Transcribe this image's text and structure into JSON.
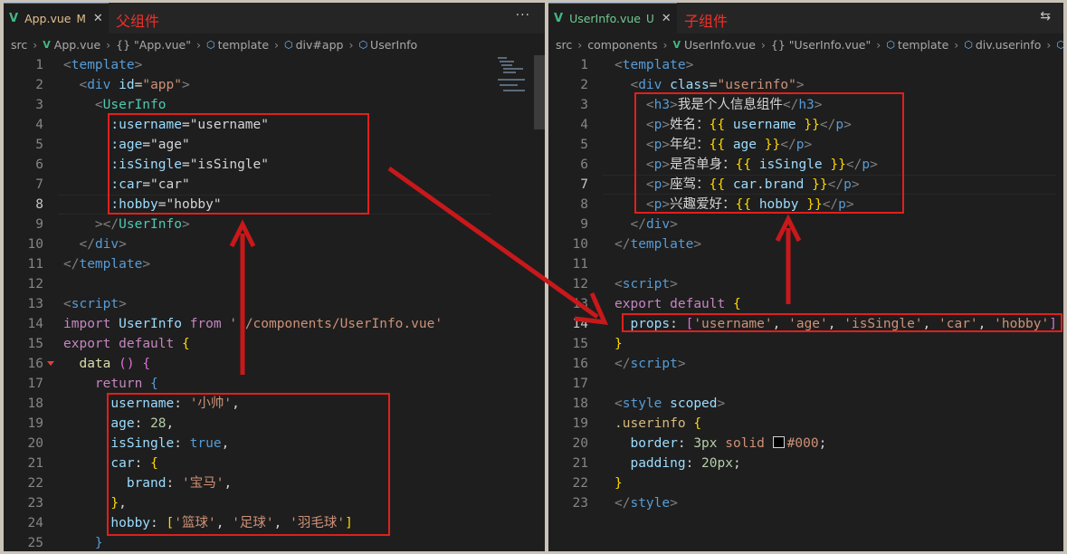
{
  "left": {
    "tab": {
      "icon": "vue-logo-icon",
      "name": "App.vue",
      "status": "M",
      "close": "✕"
    },
    "annotation": "父组件",
    "more": "···",
    "breadcrumb": [
      "src",
      "App.vue",
      "{} \"App.vue\"",
      "template",
      "div#app",
      "UserInfo"
    ],
    "lines": [
      {
        "n": "1",
        "html": "<span class='t'>&lt;</span><span class='tag'>template</span><span class='t'>&gt;</span>"
      },
      {
        "n": "2",
        "html": "  <span class='t'>&lt;</span><span class='tag'>div</span> <span class='attr'>id</span><span class='pl'>=</span><span class='str'>\"app\"</span><span class='t'>&gt;</span>"
      },
      {
        "n": "3",
        "html": "    <span class='t'>&lt;</span><span class='cls'>UserInfo</span>"
      },
      {
        "n": "4",
        "html": "      <span class='attr'>:username</span><span class='pl'>=</span><span class='pl'>\"username\"</span>"
      },
      {
        "n": "5",
        "html": "      <span class='attr'>:age</span><span class='pl'>=</span><span class='pl'>\"age\"</span>"
      },
      {
        "n": "6",
        "html": "      <span class='attr'>:isSingle</span><span class='pl'>=</span><span class='pl'>\"isSingle\"</span>"
      },
      {
        "n": "7",
        "html": "      <span class='attr'>:car</span><span class='pl'>=</span><span class='pl'>\"car\"</span>"
      },
      {
        "n": "8",
        "html": "      <span class='attr'>:hobby</span><span class='pl'>=</span><span class='pl'>\"hobby\"</span>"
      },
      {
        "n": "9",
        "html": "    <span class='t'>&gt;&lt;/</span><span class='cls'>UserInfo</span><span class='t'>&gt;</span>"
      },
      {
        "n": "10",
        "html": "  <span class='t'>&lt;/</span><span class='tag'>div</span><span class='t'>&gt;</span>"
      },
      {
        "n": "11",
        "html": "<span class='t'>&lt;/</span><span class='tag'>template</span><span class='t'>&gt;</span>"
      },
      {
        "n": "12",
        "html": ""
      },
      {
        "n": "13",
        "html": "<span class='t'>&lt;</span><span class='tag'>script</span><span class='t'>&gt;</span>"
      },
      {
        "n": "14",
        "html": "<span class='kw'>import</span> <span class='attr'>UserInfo</span> <span class='kw'>from</span> <span class='str'>'./components/UserInfo.vue'</span>"
      },
      {
        "n": "15",
        "html": "<span class='kw'>export</span> <span class='kw'>default</span> <span class='br'>{</span>"
      },
      {
        "n": "16",
        "html": "  <span class='fn'>data</span> <span class='br2'>()</span> <span class='br2'>{</span>"
      },
      {
        "n": "17",
        "html": "    <span class='kw'>return</span> <span class='kw2'>{</span>"
      },
      {
        "n": "18",
        "html": "      <span class='attr'>username</span><span class='pl'>:</span> <span class='str'>'小帅'</span><span class='pl'>,</span>"
      },
      {
        "n": "19",
        "html": "      <span class='attr'>age</span><span class='pl'>:</span> <span class='num'>28</span><span class='pl'>,</span>"
      },
      {
        "n": "20",
        "html": "      <span class='attr'>isSingle</span><span class='pl'>:</span> <span class='kw2'>true</span><span class='pl'>,</span>"
      },
      {
        "n": "21",
        "html": "      <span class='attr'>car</span><span class='pl'>:</span> <span class='br'>{</span>"
      },
      {
        "n": "22",
        "html": "        <span class='attr'>brand</span><span class='pl'>:</span> <span class='str'>'宝马'</span><span class='pl'>,</span>"
      },
      {
        "n": "23",
        "html": "      <span class='br'>}</span><span class='pl'>,</span>"
      },
      {
        "n": "24",
        "html": "      <span class='attr'>hobby</span><span class='pl'>:</span> <span class='br'>[</span><span class='str'>'篮球'</span><span class='pl'>,</span> <span class='str'>'足球'</span><span class='pl'>,</span> <span class='str'>'羽毛球'</span><span class='br'>]</span>"
      },
      {
        "n": "25",
        "html": "    <span class='kw2'>}</span>"
      }
    ]
  },
  "right": {
    "tab": {
      "icon": "vue-logo-icon",
      "name": "UserInfo.vue",
      "status": "U",
      "close": "✕"
    },
    "annotation": "子组件",
    "compare_icon": "⇆",
    "breadcrumb": [
      "src",
      "components",
      "UserInfo.vue",
      "{} \"UserInfo.vue\"",
      "template",
      "div.userinfo"
    ],
    "lines": [
      {
        "n": "1",
        "html": "<span class='t'>&lt;</span><span class='tag'>template</span><span class='t'>&gt;</span>"
      },
      {
        "n": "2",
        "html": "  <span class='t'>&lt;</span><span class='tag'>div</span> <span class='attr'>class</span><span class='pl'>=</span><span class='str'>\"userinfo\"</span><span class='t'>&gt;</span>"
      },
      {
        "n": "3",
        "html": "    <span class='t'>&lt;</span><span class='tag'>h3</span><span class='t'>&gt;</span><span class='pl'>我是个人信息组件</span><span class='t'>&lt;/</span><span class='tag'>h3</span><span class='t'>&gt;</span>"
      },
      {
        "n": "4",
        "html": "    <span class='t'>&lt;</span><span class='tag'>p</span><span class='t'>&gt;</span><span class='pl'>姓名：</span><span class='br'>{{</span> <span class='attr'>username</span> <span class='br'>}}</span><span class='t'>&lt;/</span><span class='tag'>p</span><span class='t'>&gt;</span>"
      },
      {
        "n": "5",
        "html": "    <span class='t'>&lt;</span><span class='tag'>p</span><span class='t'>&gt;</span><span class='pl'>年纪：</span><span class='br'>{{</span> <span class='attr'>age</span> <span class='br'>}}</span><span class='t'>&lt;/</span><span class='tag'>p</span><span class='t'>&gt;</span>"
      },
      {
        "n": "6",
        "html": "    <span class='t'>&lt;</span><span class='tag'>p</span><span class='t'>&gt;</span><span class='pl'>是否单身：</span><span class='br'>{{</span> <span class='attr'>isSingle</span> <span class='br'>}}</span><span class='t'>&lt;/</span><span class='tag'>p</span><span class='t'>&gt;</span>"
      },
      {
        "n": "7",
        "html": "    <span class='t'>&lt;</span><span class='tag'>p</span><span class='t'>&gt;</span><span class='pl'>座驾：</span><span class='br'>{{</span> <span class='attr'>car</span><span class='pl'>.</span><span class='attr'>brand</span> <span class='br'>}}</span><span class='t'>&lt;/</span><span class='tag'>p</span><span class='t'>&gt;</span>"
      },
      {
        "n": "8",
        "html": "    <span class='t'>&lt;</span><span class='tag'>p</span><span class='t'>&gt;</span><span class='pl'>兴趣爱好：</span><span class='br'>{{</span> <span class='attr'>hobby</span> <span class='br'>}}</span><span class='t'>&lt;/</span><span class='tag'>p</span><span class='t'>&gt;</span>"
      },
      {
        "n": "9",
        "html": "  <span class='t'>&lt;/</span><span class='tag'>div</span><span class='t'>&gt;</span>"
      },
      {
        "n": "10",
        "html": "<span class='t'>&lt;/</span><span class='tag'>template</span><span class='t'>&gt;</span>"
      },
      {
        "n": "11",
        "html": ""
      },
      {
        "n": "12",
        "html": "<span class='t'>&lt;</span><span class='tag'>script</span><span class='t'>&gt;</span>"
      },
      {
        "n": "13",
        "html": "<span class='kw'>export</span> <span class='kw'>default</span> <span class='br'>{</span>"
      },
      {
        "n": "14",
        "html": "  <span class='attr'>props</span><span class='pl'>:</span> <span class='br2'>[</span><span class='str'>'username'</span><span class='pl'>,</span> <span class='str'>'age'</span><span class='pl'>,</span> <span class='str'>'isSingle'</span><span class='pl'>,</span> <span class='str'>'car'</span><span class='pl'>,</span> <span class='str'>'hobby'</span><span class='br2'>]</span>"
      },
      {
        "n": "15",
        "html": "<span class='br'>}</span>"
      },
      {
        "n": "16",
        "html": "<span class='t'>&lt;/</span><span class='tag'>script</span><span class='t'>&gt;</span>"
      },
      {
        "n": "17",
        "html": ""
      },
      {
        "n": "18",
        "html": "<span class='t'>&lt;</span><span class='tag'>style</span> <span class='attr'>scoped</span><span class='t'>&gt;</span>"
      },
      {
        "n": "19",
        "html": "<span class='sel'>.userinfo</span> <span class='br'>{</span>"
      },
      {
        "n": "20",
        "html": "  <span class='attr'>border</span><span class='pl'>:</span> <span class='num'>3px</span> <span class='str'>solid</span> <span class='sq'></span><span class='str'>#000</span><span class='pl'>;</span>"
      },
      {
        "n": "21",
        "html": "  <span class='attr'>padding</span><span class='pl'>:</span> <span class='num'>20px</span><span class='pl'>;</span>"
      },
      {
        "n": "22",
        "html": "<span class='br'>}</span>"
      },
      {
        "n": "23",
        "html": "<span class='t'>&lt;/</span><span class='tag'>style</span><span class='t'>&gt;</span>"
      }
    ]
  },
  "colors": {
    "annotation_red": "#e0201c",
    "vue_green": "#41b883",
    "bg": "#1e1e1e"
  }
}
